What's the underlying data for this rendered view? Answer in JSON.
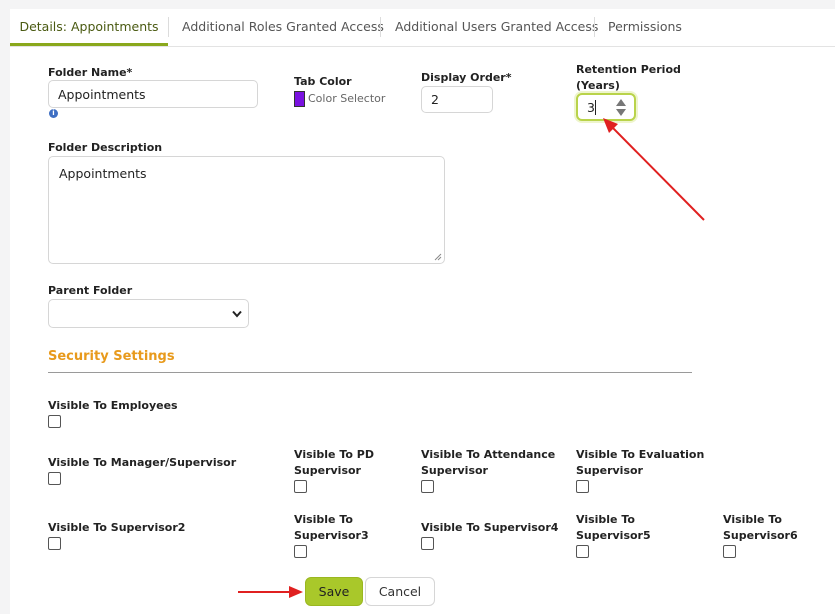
{
  "tabs": [
    {
      "label": "Details: Appointments"
    },
    {
      "label": "Additional Roles Granted Access"
    },
    {
      "label": "Additional Users Granted Access"
    },
    {
      "label": "Permissions"
    }
  ],
  "form": {
    "folder_name_label": "Folder Name*",
    "folder_name_value": "Appointments",
    "tab_color_label": "Tab Color",
    "tab_color_value": "#7a12e0",
    "color_selector_label": "Color Selector",
    "display_order_label": "Display Order*",
    "display_order_value": "2",
    "retention_label_line1": "Retention Period",
    "retention_label_line2": "(Years)",
    "retention_value": "3",
    "description_label": "Folder Description",
    "description_value": "Appointments",
    "parent_folder_label": "Parent Folder",
    "parent_folder_value": ""
  },
  "security": {
    "title": "Security Settings",
    "employees": "Visible To Employees",
    "manager": "Visible To Manager/Supervisor",
    "pd_1": "Visible To PD",
    "pd_2": "Supervisor",
    "att_1": "Visible To Attendance",
    "att_2": "Supervisor",
    "eval_1": "Visible To Evaluation",
    "eval_2": "Supervisor",
    "sup2": "Visible To Supervisor2",
    "sup3_1": "Visible To",
    "sup3_2": "Supervisor3",
    "sup4": "Visible To Supervisor4",
    "sup5_1": "Visible To",
    "sup5_2": "Supervisor5",
    "sup6_1": "Visible To",
    "sup6_2": "Supervisor6"
  },
  "actions": {
    "save": "Save",
    "cancel": "Cancel"
  },
  "colors": {
    "accent": "#a9c82a",
    "section": "#e89a1c",
    "annotation": "#e02020"
  }
}
